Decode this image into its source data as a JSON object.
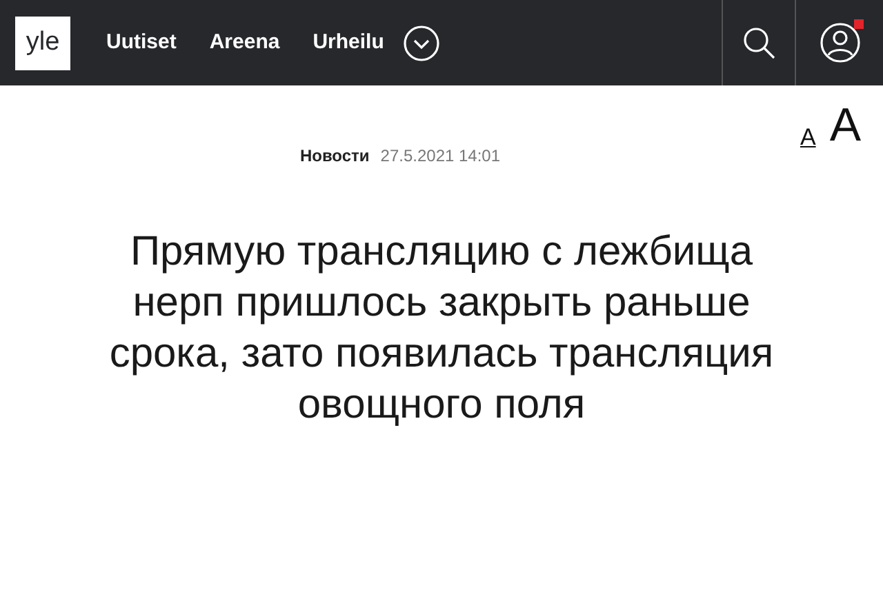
{
  "header": {
    "logo": "yle",
    "nav": [
      {
        "label": "Uutiset"
      },
      {
        "label": "Areena"
      },
      {
        "label": "Urheilu"
      }
    ],
    "notification": true
  },
  "text_size": [
    {
      "label": "A",
      "selected": true
    },
    {
      "label": "A",
      "selected": false
    }
  ],
  "article": {
    "category": "Новости",
    "date": "27.5.2021 14:01",
    "headline": "Прямую трансляцию с лежбища нерп пришлось закрыть раньше срока, зато появилась трансляция овощного поля"
  }
}
